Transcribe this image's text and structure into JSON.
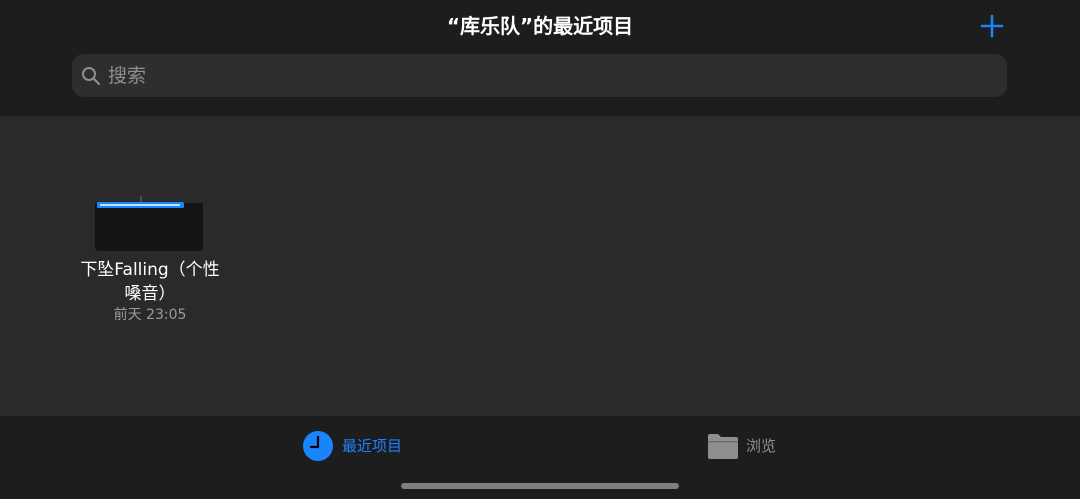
{
  "header": {
    "title": "“库乐队”的最近项目",
    "add_icon": "plus-icon",
    "accent_color": "#1a84ff"
  },
  "search": {
    "placeholder": "搜索",
    "value": "",
    "icon": "magnifying-glass-icon"
  },
  "projects": [
    {
      "name": "下坠Falling（个性嗓音）",
      "date": "前天 23:05",
      "thumbnail_icon": "audio-region-thumbnail"
    }
  ],
  "tabbar": {
    "tabs": [
      {
        "label": "最近项目",
        "icon": "clock-icon",
        "selected": true
      },
      {
        "label": "浏览",
        "icon": "folder-icon",
        "selected": false
      }
    ]
  },
  "colors": {
    "header_background": "#1d1d1d",
    "content_background": "#2a2a2a",
    "selected_tab": "#1a84ff",
    "unselected_tab": "#8e8e8e"
  }
}
